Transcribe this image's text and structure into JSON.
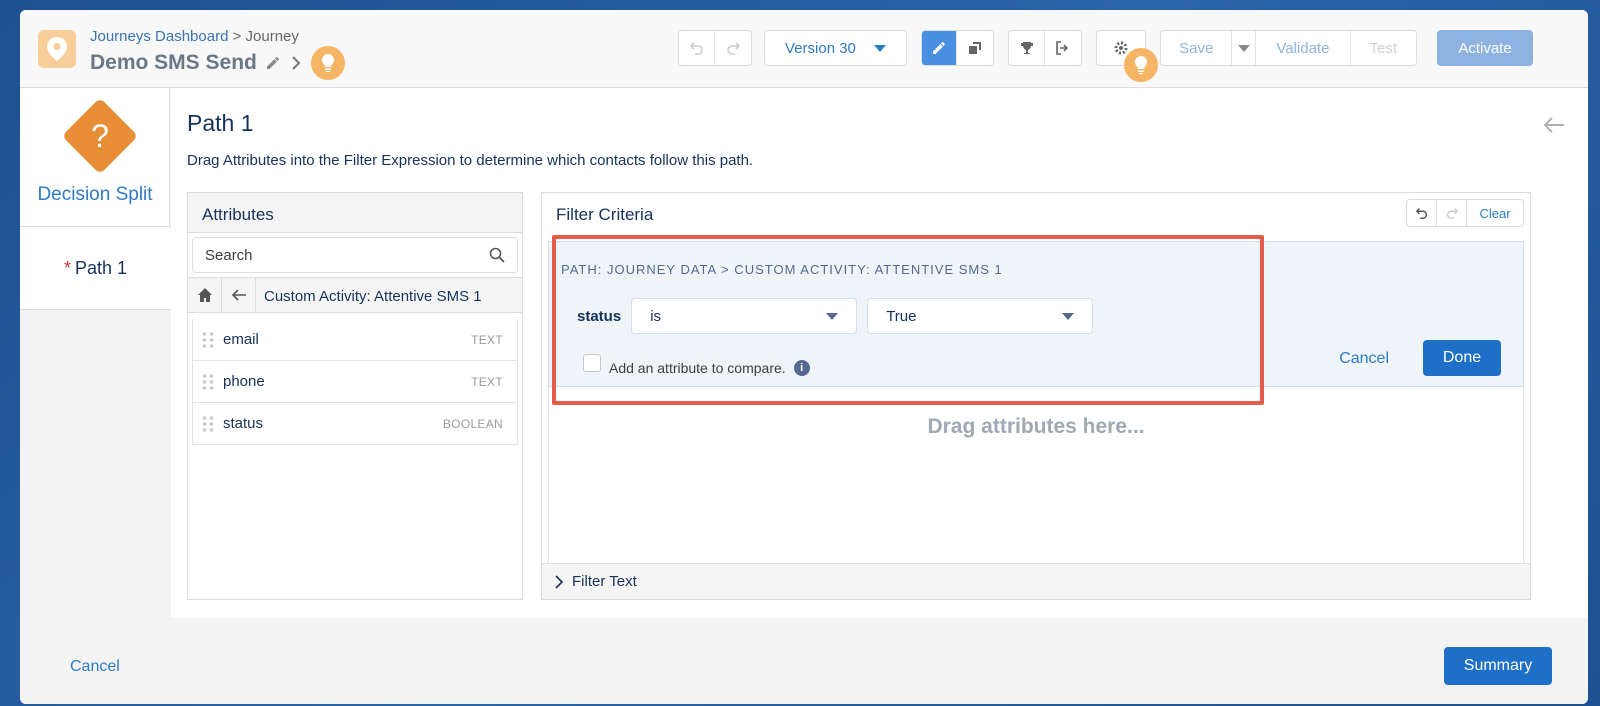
{
  "header": {
    "breadcrumb_dashboard": "Journeys Dashboard",
    "breadcrumb_sep": ">",
    "breadcrumb_current": "Journey",
    "title": "Demo SMS Send",
    "version_label": "Version 30",
    "save_label": "Save",
    "validate_label": "Validate",
    "test_label": "Test",
    "activate_label": "Activate"
  },
  "left_rail": {
    "activity_label": "Decision Split",
    "activity_symbol": "?",
    "path_required_mark": "*",
    "path_label": "Path 1"
  },
  "main": {
    "title": "Path 1",
    "description": "Drag Attributes into the Filter Expression to determine which contacts follow this path."
  },
  "attributes": {
    "title": "Attributes",
    "search_placeholder": "Search",
    "current_folder": "Custom Activity: Attentive SMS 1",
    "items": [
      {
        "name": "email",
        "type": "TEXT"
      },
      {
        "name": "phone",
        "type": "TEXT"
      },
      {
        "name": "status",
        "type": "BOOLEAN"
      }
    ]
  },
  "filter": {
    "title": "Filter Criteria",
    "clear_label": "Clear",
    "path_text": "PATH: JOURNEY DATA > CUSTOM ACTIVITY: ATTENTIVE SMS 1",
    "attribute_label": "status",
    "operator_value": "is",
    "value_value": "True",
    "compare_label": "Add an attribute to compare.",
    "info_symbol": "i",
    "cancel_label": "Cancel",
    "done_label": "Done",
    "drag_hint": "Drag attributes here...",
    "filter_text_label": "Filter Text"
  },
  "footer": {
    "cancel_label": "Cancel",
    "summary_label": "Summary"
  },
  "colors": {
    "accent": "#1e6fc8",
    "highlight_border": "#e45c4a",
    "decision_orange": "#e68d35"
  }
}
